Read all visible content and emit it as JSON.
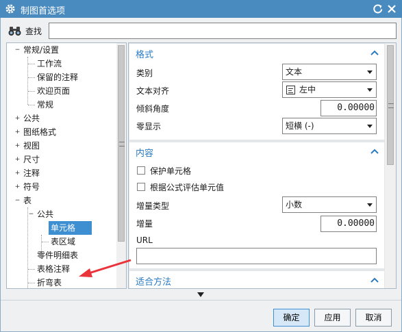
{
  "window": {
    "title": "制图首选项"
  },
  "search": {
    "label": "查找",
    "value": ""
  },
  "tree": {
    "items": [
      {
        "label": "常规/设置",
        "expander": "−"
      },
      {
        "label": "工作流"
      },
      {
        "label": "保留的注释"
      },
      {
        "label": "欢迎页面"
      },
      {
        "label": "常规"
      },
      {
        "label": "公共",
        "expander": "+"
      },
      {
        "label": "图纸格式",
        "expander": "+"
      },
      {
        "label": "视图",
        "expander": "+"
      },
      {
        "label": "尺寸",
        "expander": "+"
      },
      {
        "label": "注释",
        "expander": "+"
      },
      {
        "label": "符号",
        "expander": "+"
      },
      {
        "label": "表",
        "expander": "−"
      },
      {
        "label": "公共",
        "expander": "−"
      },
      {
        "label": "单元格",
        "selected": true
      },
      {
        "label": "表区域"
      },
      {
        "label": "零件明细表"
      },
      {
        "label": "表格注释"
      },
      {
        "label": "折弯表"
      }
    ]
  },
  "format_section": {
    "title": "格式",
    "category_label": "类别",
    "category_value": "文本",
    "align_label": "文本对齐",
    "align_value": "左中",
    "angle_label": "倾斜角度",
    "angle_value": "0.00000",
    "zero_label": "零显示",
    "zero_value": "短横 (-)"
  },
  "content_section": {
    "title": "内容",
    "protect_label": "保护单元格",
    "protect_checked": false,
    "formula_label": "根据公式评估单元值",
    "formula_checked": false,
    "increment_type_label": "增量类型",
    "increment_type_value": "小数",
    "increment_label": "增量",
    "increment_value": "0.00000",
    "url_label": "URL",
    "url_value": ""
  },
  "fit_section": {
    "title": "适合方法"
  },
  "buttons": {
    "ok": "确定",
    "apply": "应用",
    "cancel": "取消"
  },
  "colors": {
    "titlebar": "#4a8bbf",
    "accent": "#2a7ac0",
    "selection": "#3d8fd1",
    "annotation_arrow": "#e8343a"
  },
  "icons": {
    "title": "gear-icon",
    "reset": "reset-icon",
    "close": "close-icon",
    "search": "binoculars-icon",
    "collapse": "chevron-up-icon",
    "dropdown": "chevron-down-icon",
    "more": "triangle-down-icon"
  }
}
